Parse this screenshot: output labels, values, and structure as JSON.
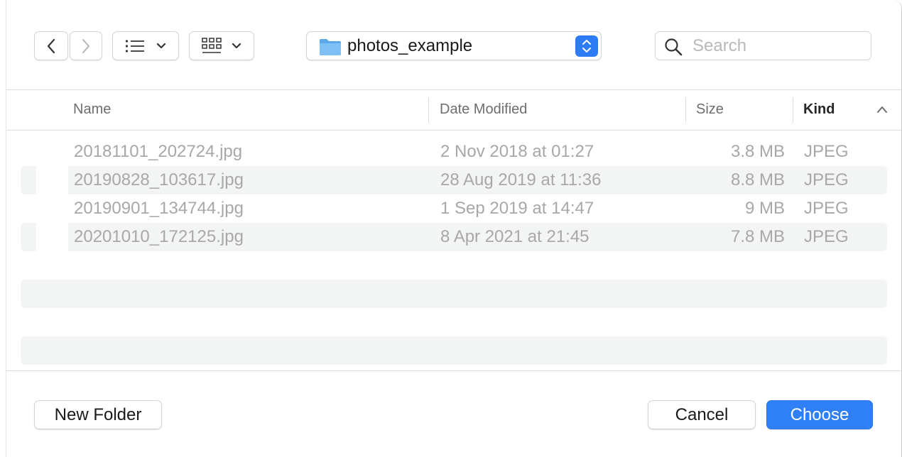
{
  "toolbar": {
    "back_icon": "chevron-left-icon",
    "forward_icon": "chevron-right-icon",
    "list_view_icon": "list-icon",
    "grid_view_icon": "grid-icon",
    "path": {
      "folder_icon": "folder-icon",
      "label": "photos_example"
    },
    "search": {
      "placeholder": "Search",
      "value": ""
    }
  },
  "table": {
    "columns": [
      "Name",
      "Date Modified",
      "Size",
      "Kind"
    ],
    "sort_column": "Kind",
    "sort_direction": "ascending",
    "rows": [
      {
        "name": "20181101_202724.jpg",
        "date": "2 Nov 2018 at 01:27",
        "size": "3.8 MB",
        "kind": "JPEG"
      },
      {
        "name": "20190828_103617.jpg",
        "date": "28 Aug 2019 at 11:36",
        "size": "8.8 MB",
        "kind": "JPEG"
      },
      {
        "name": "20190901_134744.jpg",
        "date": "1 Sep 2019 at 14:47",
        "size": "9 MB",
        "kind": "JPEG"
      },
      {
        "name": "20201010_172125.jpg",
        "date": "8 Apr 2021 at 21:45",
        "size": "7.8 MB",
        "kind": "JPEG"
      }
    ]
  },
  "footer": {
    "new_folder_label": "New Folder",
    "cancel_label": "Cancel",
    "choose_label": "Choose"
  },
  "colors": {
    "accent": "#2f7ff7",
    "stripe": "#f3f4f4",
    "dimmed_text": "#a8a8a8"
  }
}
